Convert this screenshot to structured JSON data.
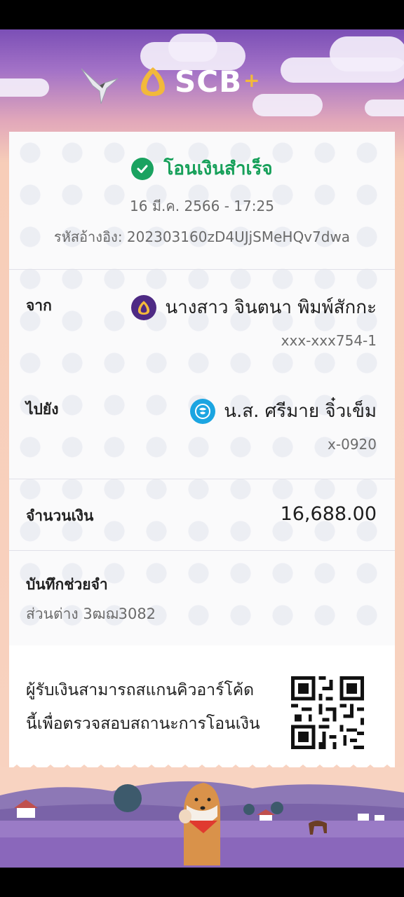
{
  "brand": {
    "name": "SCB",
    "plus": "+"
  },
  "receipt": {
    "status": "โอนเงินสำเร็จ",
    "datetime": "16 มี.ค. 2566 - 17:25",
    "reference": "รหัสอ้างอิง: 202303160zD4UJjSMeHQv7dwa"
  },
  "from": {
    "label": "จาก",
    "name": "นางสาว จินตนา พิมพ์สักกะ",
    "account": "xxx-xxx754-1",
    "bank_icon": "scb-icon",
    "bank_color": "#4e2a84"
  },
  "to": {
    "label": "ไปยัง",
    "name": "น.ส. ศรีมาย จิ๋วเข็ม",
    "account": "x-0920",
    "bank_icon": "ktb-icon",
    "bank_color": "#1ba5e1"
  },
  "amount": {
    "label": "จำนวนเงิน",
    "value": "16,688.00"
  },
  "memo": {
    "label": "บันทึกช่วยจำ",
    "value": "ส่วนต่าง 3ฒฌ3082"
  },
  "qr": {
    "text": "ผู้รับเงินสามารถสแกนคิวอาร์โค้ดนี้เพื่อตรวจสอบสถานะการโอนเงิน"
  },
  "colors": {
    "success": "#17a05a",
    "brand_gold": "#f2b93b",
    "brand_purple": "#7b4fb6"
  }
}
